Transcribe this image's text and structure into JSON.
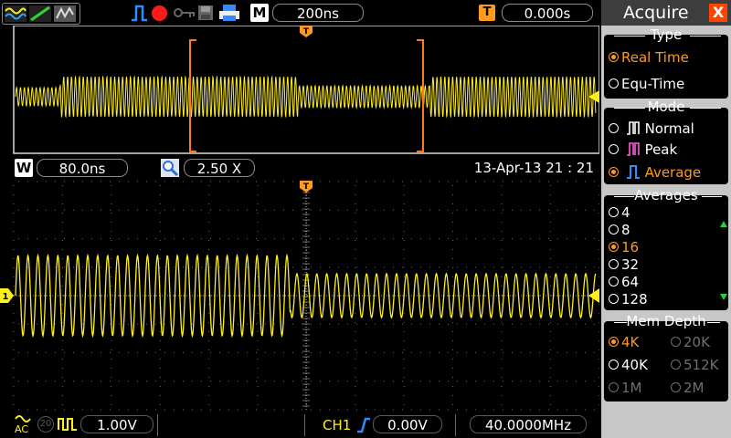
{
  "top": {
    "timebase": "200ns",
    "trigger_icon": "T",
    "trigger_position": "0.000s",
    "m_label": "M"
  },
  "zoom": {
    "w_label": "W",
    "window": "80.0ns",
    "factor": "2.50 X",
    "datetime": "13-Apr-13 21 : 21"
  },
  "bottom": {
    "ch1_scale": "1.00V",
    "ch1_label": "CH1",
    "trigger_level": "0.00V",
    "frequency": "40.0000MHz",
    "coupling": "AC",
    "bw_label": "20"
  },
  "menu": {
    "title": "Acquire",
    "close": "X",
    "type": {
      "title": "Type",
      "options": [
        {
          "label": "Real Time",
          "selected": true
        },
        {
          "label": "Equ-Time",
          "selected": false
        }
      ]
    },
    "mode": {
      "title": "Mode",
      "options": [
        {
          "label": "Normal",
          "selected": false
        },
        {
          "label": "Peak",
          "selected": false
        },
        {
          "label": "Average",
          "selected": true
        }
      ]
    },
    "averages": {
      "title": "Averages",
      "options": [
        {
          "label": "4",
          "selected": false
        },
        {
          "label": "8",
          "selected": false
        },
        {
          "label": "16",
          "selected": true
        },
        {
          "label": "32",
          "selected": false
        },
        {
          "label": "64",
          "selected": false
        },
        {
          "label": "128",
          "selected": false
        }
      ]
    },
    "memdepth": {
      "title": "Mem Depth",
      "options": [
        {
          "label": "4K",
          "state": "selected"
        },
        {
          "label": "20K",
          "state": "disabled"
        },
        {
          "label": "40K",
          "state": "normal"
        },
        {
          "label": "512K",
          "state": "disabled"
        },
        {
          "label": "1M",
          "state": "disabled"
        },
        {
          "label": "2M",
          "state": "disabled"
        }
      ]
    }
  },
  "colors": {
    "trace": "#ffef1a",
    "accent": "#ff9a1e",
    "trigger_marker": "#ff9a1e",
    "stop_indicator": "#ff1a1a",
    "menu_bg": "#c7c7c7"
  },
  "icons": [
    "wave-display-icon",
    "trigger-edge-icon",
    "run-stop-icon",
    "key-icon",
    "save-icon",
    "print-icon",
    "zoom-icon",
    "rising-edge-icon"
  ]
}
